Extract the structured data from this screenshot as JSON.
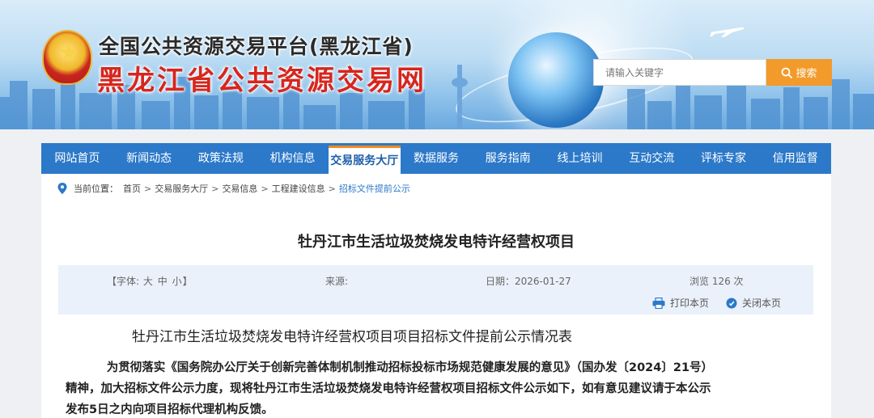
{
  "header": {
    "title_line1": "全国公共资源交易平台(黑龙江省)",
    "title_line2": "黑龙江省公共资源交易网",
    "search_placeholder": "请输入关键字",
    "search_button": "搜索"
  },
  "nav": {
    "items": [
      {
        "label": "网站首页"
      },
      {
        "label": "新闻动态"
      },
      {
        "label": "政策法规"
      },
      {
        "label": "机构信息"
      },
      {
        "label": "交易服务大厅"
      },
      {
        "label": "数据服务"
      },
      {
        "label": "服务指南"
      },
      {
        "label": "线上培训"
      },
      {
        "label": "互动交流"
      },
      {
        "label": "评标专家"
      },
      {
        "label": "信用监督"
      }
    ],
    "active_label": "交易服务大厅"
  },
  "breadcrumb": {
    "prefix": "当前位置：",
    "items": [
      "首页",
      "交易服务大厅",
      "交易信息",
      "工程建设信息",
      "招标文件提前公示"
    ],
    "separator": ">"
  },
  "article": {
    "title": "牡丹江市生活垃圾焚烧发电特许经营权项目",
    "meta": {
      "font_label": "【字体:",
      "font_large": "大",
      "font_medium": "中",
      "font_small": "小",
      "font_end": "】",
      "source": "来源:",
      "date": "日期：2026-01-27",
      "views": "浏览 126 次"
    },
    "actions": {
      "print": "打印本页",
      "close": "关闭本页"
    },
    "subtitle": "牡丹江市生活垃圾焚烧发电特许经营权项目项目招标文件提前公示情况表",
    "body": "为贯彻落实《国务院办公厅关于创新完善体制机制推动招标投标市场规范健康发展的意见》（国办发〔2024〕21号）精神，加大招标文件公示力度，现将牡丹江市生活垃圾焚烧发电特许经营权项目招标文件公示如下，如有意见建议请于本公示发布5日之内向项目招标代理机构反馈。"
  },
  "colors": {
    "nav_blue": "#2c79c9",
    "accent_orange": "#f29a2a",
    "title_red": "#d7261d",
    "meta_bg": "#eaf1fa"
  },
  "icons": [
    "emblem-icon",
    "search-icon",
    "location-icon",
    "print-icon",
    "close-icon",
    "plane-icon"
  ]
}
